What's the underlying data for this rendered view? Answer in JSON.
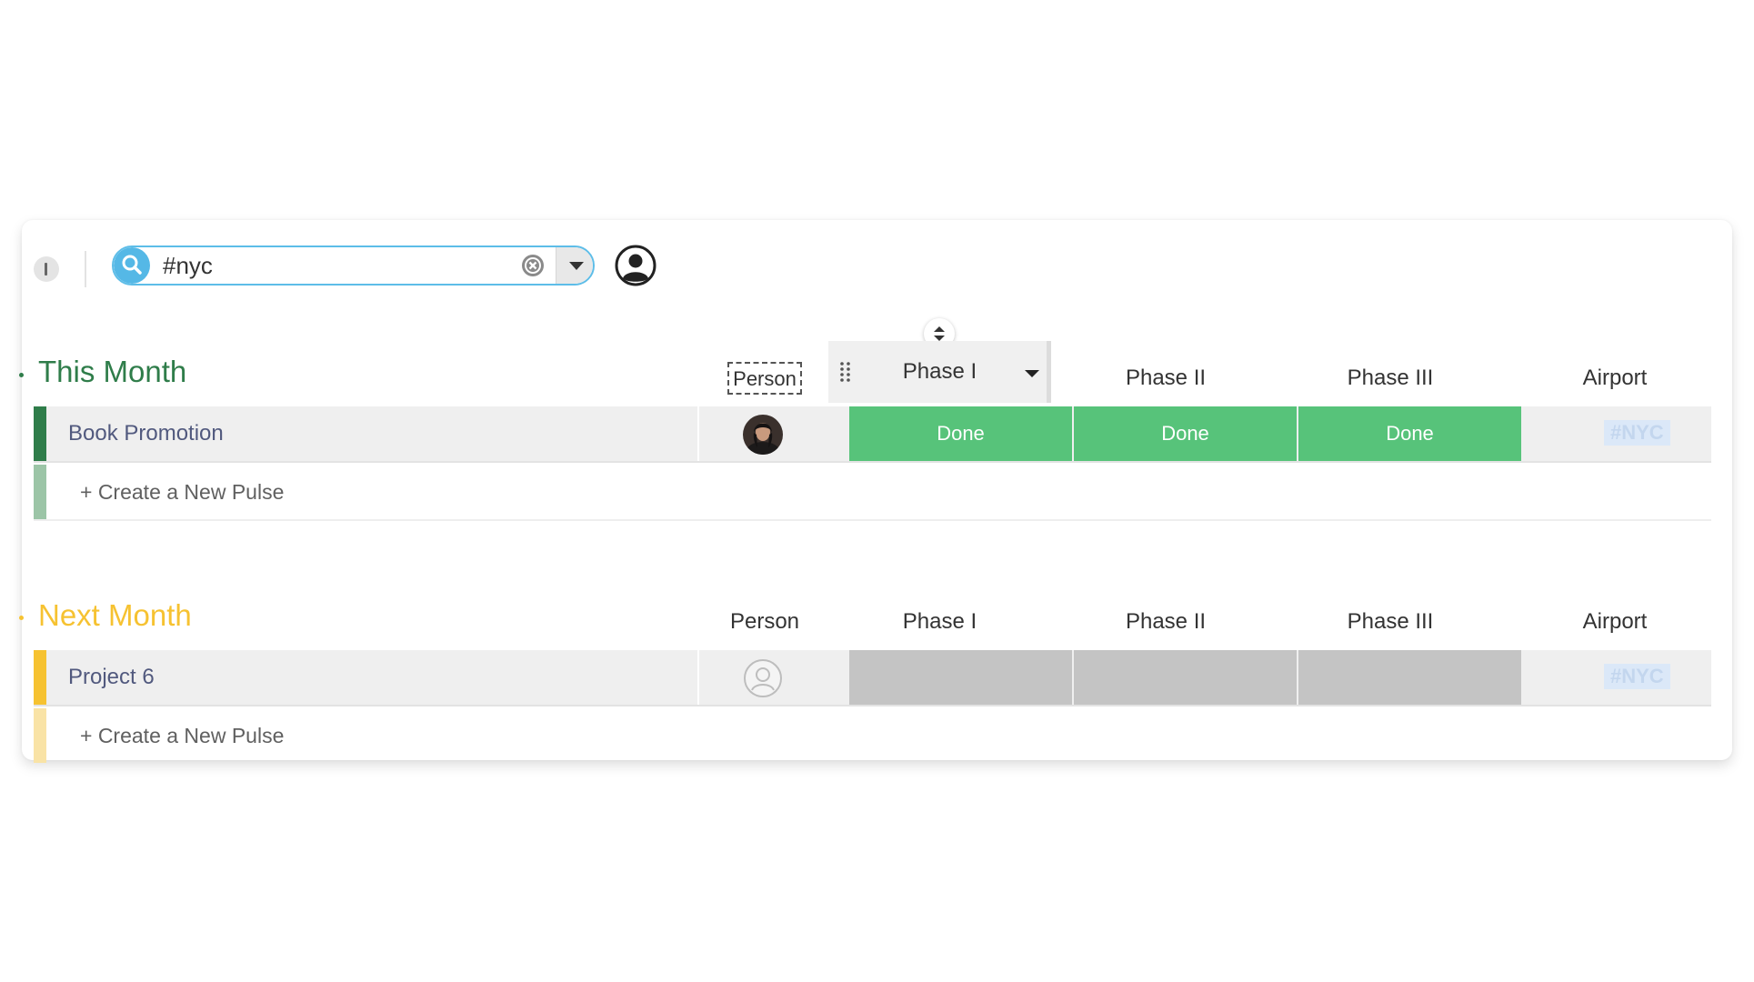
{
  "toolbar": {
    "search_value": "#nyc",
    "icons": [
      "collapse-icon",
      "search-icon",
      "clear-icon",
      "dropdown-arrow-icon",
      "user-filter-icon"
    ]
  },
  "colors": {
    "accent_blue": "#5dbde8",
    "this_month": "#2f7d4a",
    "next_month": "#f6c231",
    "done": "#57c37a",
    "empty_status": "#c4c4c4",
    "pulse_name": "#51597e",
    "tag_bg": "#dbe8f8",
    "tag_text": "#c3d6ee"
  },
  "groups": [
    {
      "title": "This Month",
      "columns": [
        "Person",
        "Phase I",
        "Phase II",
        "Phase III",
        "Airport"
      ],
      "pulses": [
        {
          "name": "Book Promotion",
          "person": "avatar-photo",
          "phase1": "Done",
          "phase2": "Done",
          "phase3": "Done",
          "airport": "#NYC"
        }
      ],
      "new_pulse_label": "+ Create a New Pulse"
    },
    {
      "title": "Next Month",
      "columns": [
        "Person",
        "Phase I",
        "Phase II",
        "Phase III",
        "Airport"
      ],
      "pulses": [
        {
          "name": "Project 6",
          "person": "empty-avatar",
          "phase1": "",
          "phase2": "",
          "phase3": "",
          "airport": "#NYC"
        }
      ],
      "new_pulse_label": "+ Create a New Pulse"
    }
  ]
}
